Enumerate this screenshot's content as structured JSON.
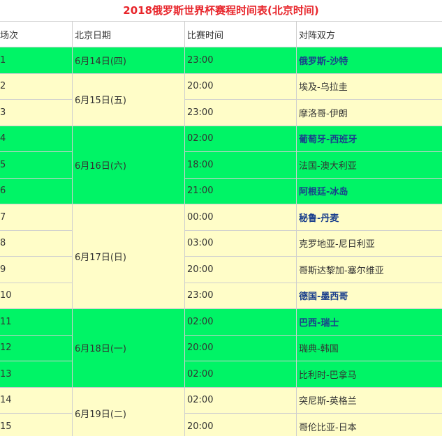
{
  "title": "2018俄罗斯世界杯赛程时间表(北京时间)",
  "colors": {
    "title": "#e8252b",
    "green_row": "#00f466",
    "yellow_row": "#fffdc8",
    "bold_team": "#1a3f8c"
  },
  "columns": [
    "场次",
    "北京日期",
    "比赛时间",
    "对阵双方"
  ],
  "dates": [
    {
      "label": "6月14日(四)",
      "rows": 1,
      "color": "green"
    },
    {
      "label": "6月15日(五)",
      "rows": 2,
      "color": "yellow"
    },
    {
      "label": "6月16日(六)",
      "rows": 3,
      "color": "green"
    },
    {
      "label": "6月17日(日)",
      "rows": 4,
      "color": "yellow"
    },
    {
      "label": "6月18日(一)",
      "rows": 3,
      "color": "green"
    },
    {
      "label": "6月19日(二)",
      "rows": 2,
      "color": "yellow"
    }
  ],
  "matches": [
    {
      "no": "1",
      "time": "23:00",
      "teams": "俄罗斯-沙特",
      "bold": true
    },
    {
      "no": "2",
      "time": "20:00",
      "teams": "埃及-乌拉圭",
      "bold": false
    },
    {
      "no": "3",
      "time": "23:00",
      "teams": "摩洛哥-伊朗",
      "bold": false
    },
    {
      "no": "4",
      "time": "02:00",
      "teams": "葡萄牙-西班牙",
      "bold": true
    },
    {
      "no": "5",
      "time": "18:00",
      "teams": "法国-澳大利亚",
      "bold": false
    },
    {
      "no": "6",
      "time": "21:00",
      "teams": "阿根廷-冰岛",
      "bold": true
    },
    {
      "no": "7",
      "time": "00:00",
      "teams": "秘鲁-丹麦",
      "bold": true
    },
    {
      "no": "8",
      "time": "03:00",
      "teams": "克罗地亚-尼日利亚",
      "bold": false
    },
    {
      "no": "9",
      "time": "20:00",
      "teams": "哥斯达黎加-塞尔维亚",
      "bold": false
    },
    {
      "no": "10",
      "time": "23:00",
      "teams": "德国-墨西哥",
      "bold": true
    },
    {
      "no": "11",
      "time": "02:00",
      "teams": "巴西-瑞士",
      "bold": true
    },
    {
      "no": "12",
      "time": "20:00",
      "teams": "瑞典-韩国",
      "bold": false
    },
    {
      "no": "13",
      "time": "02:00",
      "teams": "比利时-巴拿马",
      "bold": false
    },
    {
      "no": "14",
      "time": "02:00",
      "teams": "突尼斯-英格兰",
      "bold": false
    },
    {
      "no": "15",
      "time": "20:00",
      "teams": "哥伦比亚-日本",
      "bold": false
    }
  ]
}
